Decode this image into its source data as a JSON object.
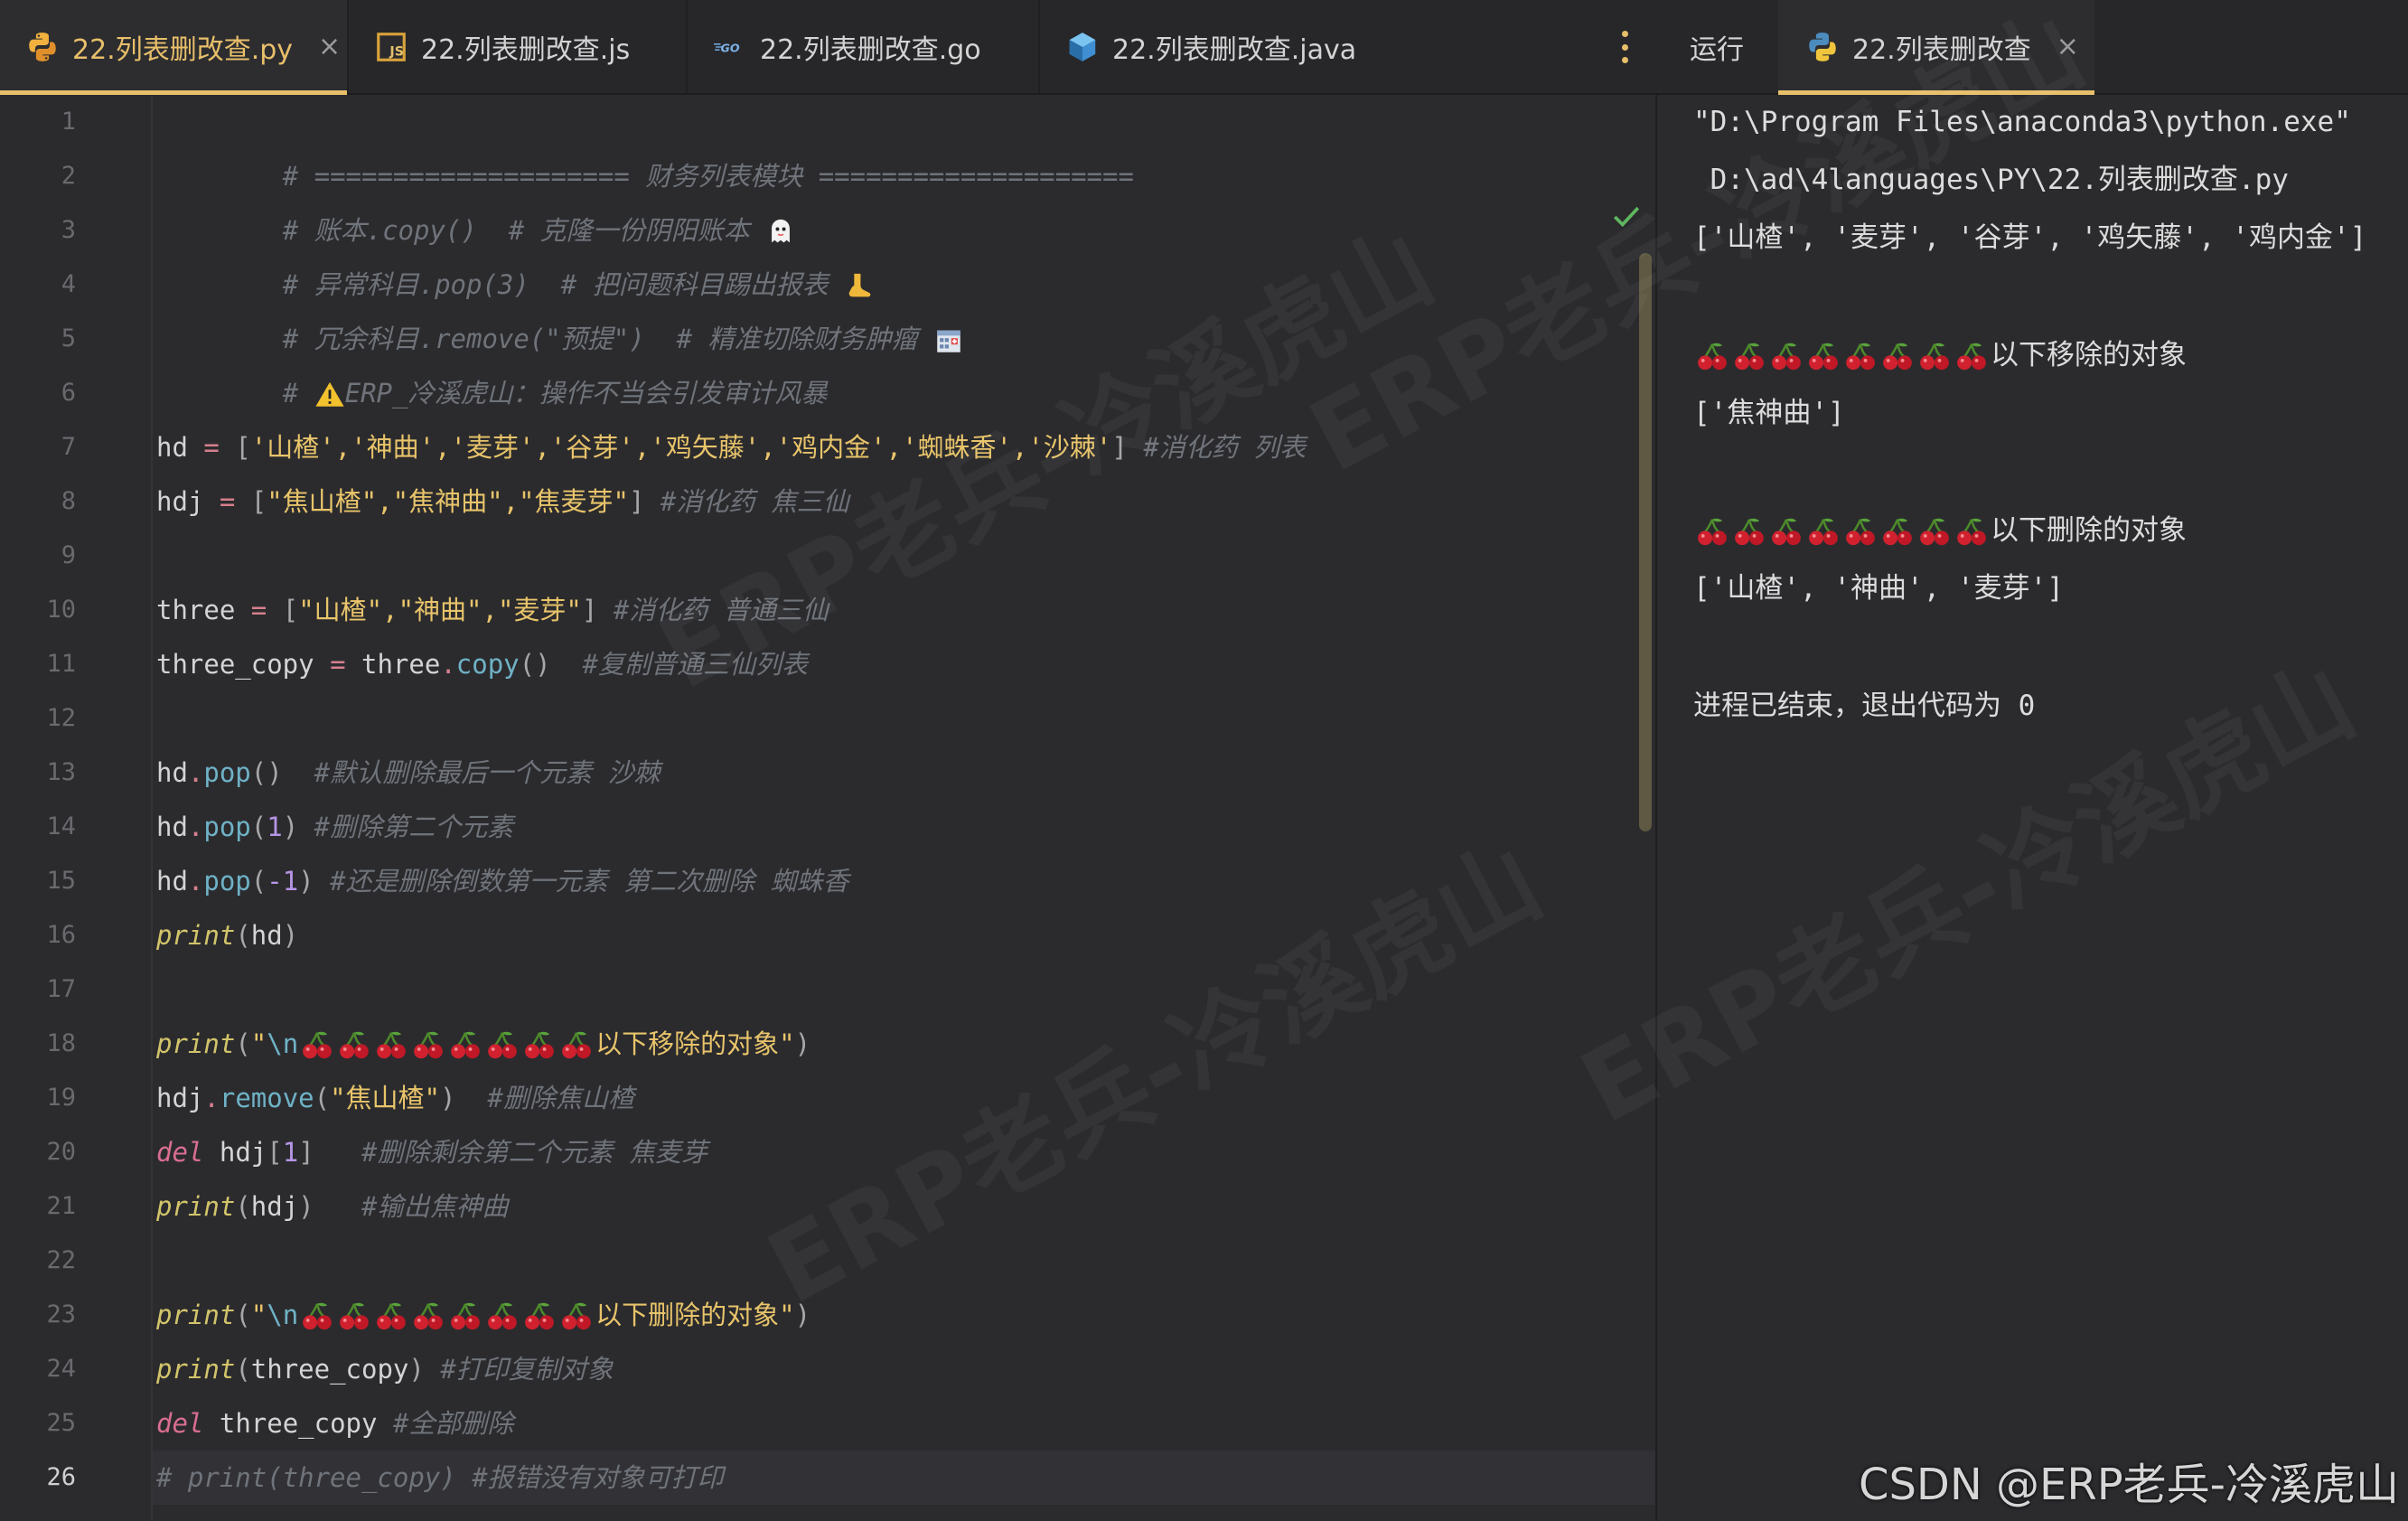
{
  "tabs": {
    "editor": [
      {
        "label": "22.列表删改查.py",
        "icon": "python-icon",
        "active": true,
        "closable": true
      },
      {
        "label": "22.列表删改查.js",
        "icon": "javascript-icon",
        "active": false,
        "closable": false
      },
      {
        "label": "22.列表删改查.go",
        "icon": "go-icon",
        "active": false,
        "closable": false
      },
      {
        "label": "22.列表删改查.java",
        "icon": "java-icon",
        "active": false,
        "closable": false
      }
    ],
    "close_symbol": "×",
    "more_icon": "more-vertical-icon"
  },
  "run": {
    "label": "运行",
    "tab_label": "22.列表删改查",
    "tab_icon": "python-icon",
    "output": {
      "cmd1": "\"D:\\Program Files\\anaconda3\\python.exe\"",
      "cmd2": " D:\\ad\\4languages\\PY\\22.列表删改查.py",
      "list1": "['山楂', '麦芽', '谷芽', '鸡矢藤', '鸡内金']",
      "header_removed": "以下移除的对象",
      "list2": "['焦神曲']",
      "header_deleted": "以下删除的对象",
      "list3": "['山楂', '神曲', '麦芽']",
      "exit": "进程已结束，退出代码为 0"
    }
  },
  "editor": {
    "line_numbers": [
      "1",
      "2",
      "3",
      "4",
      "5",
      "6",
      "7",
      "8",
      "9",
      "10",
      "11",
      "12",
      "13",
      "14",
      "15",
      "16",
      "17",
      "18",
      "19",
      "20",
      "21",
      "22",
      "23",
      "24",
      "25",
      "26"
    ],
    "current_line": 26,
    "code": {
      "l1": "# ==================== 财务列表模块 ====================",
      "l2": "# 账本.copy()  # 克隆一份阴阳账本 ",
      "l3": "# 异常科目.pop(3)  # 把问题科目踢出报表 ",
      "l4": "# 冗余科目.remove(\"预提\")  # 精准切除财务肿瘤 ",
      "l5a": "# ",
      "l5b": "ERP_冷溪虎山：操作不当会引发审计风暴",
      "l7_var": "hd",
      "l7_list": "'山楂','神曲','麦芽','谷芽','鸡矢藤','鸡内金','蜘蛛香','沙棘'",
      "l7_cm": "#消化药 列表",
      "l8_var": "hdj",
      "l8_list": "\"焦山楂\",\"焦神曲\",\"焦麦芽\"",
      "l8_cm": "#消化药 焦三仙",
      "l10_var": "three",
      "l10_list": "\"山楂\",\"神曲\",\"麦芽\"",
      "l10_cm": "#消化药 普通三仙",
      "l11_var": "three_copy",
      "l11_obj": "three",
      "l11_meth": "copy",
      "l11_cm": "#复制普通三仙列表",
      "l13_cm": "#默认删除最后一个元素 沙棘",
      "l14_cm": "#删除第二个元素",
      "l15_cm": "#还是删除倒数第一元素 第二次删除 蜘蛛香",
      "print": "print",
      "pop": "pop",
      "remove": "remove",
      "del": "del",
      "hd": "hd",
      "hdj": "hdj",
      "one": "1",
      "neg_one": "-1",
      "esc_n": "\\n",
      "l18_str": "以下移除的对象\"",
      "l19_str": "\"焦山楂\"",
      "l19_cm": "#删除焦山楂",
      "l20_cm": "#删除剩余第二个元素 焦麦芽",
      "l21_cm": "#输出焦神曲",
      "l23_str": "以下删除的对象\"",
      "three_copy": "three_copy",
      "l24_cm": "#打印复制对象",
      "l25_cm": "#全部删除",
      "l26": "# print(three_copy) #报错没有对象可打印"
    }
  },
  "footer": {
    "watermark": "CSDN @ERP老兵-冷溪虎山",
    "bg_watermark": "ERP老兵-冷溪虎山"
  },
  "colors": {
    "accent": "#e8bf6a",
    "comment": "#6f737a",
    "string": "#e8c46a",
    "keyword": "#d96e90",
    "method": "#6fb2c6",
    "number": "#b795e6",
    "background": "#2b2b2e"
  }
}
